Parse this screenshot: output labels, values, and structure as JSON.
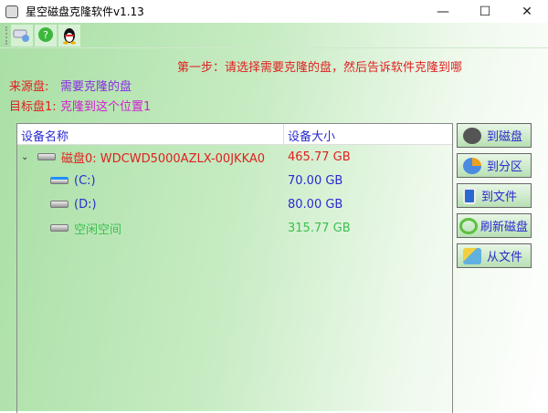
{
  "window": {
    "title": "星空磁盘克隆软件v1.13",
    "minimize": "—",
    "maximize": "☐",
    "close": "✕"
  },
  "toolbar": {
    "icons": [
      "disk-settings-icon",
      "help-icon",
      "qq-penguin-icon"
    ]
  },
  "step": "第一步：请选择需要克隆的盘，然后告诉软件克隆到哪",
  "source": {
    "label": "来源盘:",
    "value": "需要克隆的盘"
  },
  "target": {
    "label": "目标盘1:",
    "value": "克隆到这个位置1"
  },
  "table": {
    "headers": [
      "设备名称",
      "设备大小"
    ],
    "rows": [
      {
        "name": "磁盘0: WDCWD5000AZLX-00JKKA0",
        "size": "465.77 GB",
        "color": "#e02020"
      },
      {
        "name": "(C:)",
        "size": "70.00 GB",
        "color": "#2a2ad0"
      },
      {
        "name": "(D:)",
        "size": "80.00 GB",
        "color": "#2a2ad0"
      },
      {
        "name": "空闲空间",
        "size": "315.77 GB",
        "color": "#3cbf50"
      }
    ]
  },
  "buttons": [
    "到磁盘",
    "到分区",
    "到文件",
    "刷新磁盘",
    "从文件"
  ],
  "colors": {
    "label": "#e02020",
    "source": "#8a2be2",
    "target": "#d020d0"
  }
}
